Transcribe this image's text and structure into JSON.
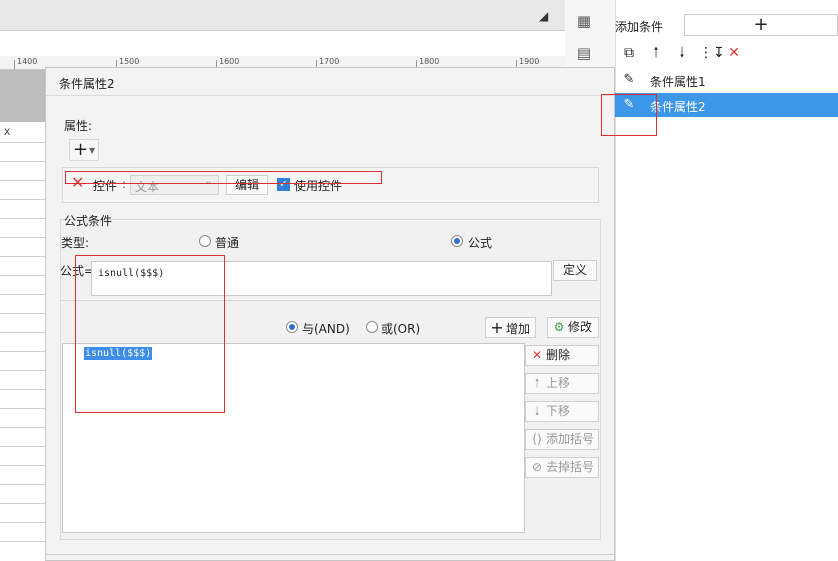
{
  "sheet": {
    "ruler_ticks": [
      "1400",
      "1500",
      "1600",
      "1700",
      "1800",
      "1900"
    ],
    "column_header": "X"
  },
  "right_panel": {
    "add_condition_label": "添加条件",
    "add_condition_button": "+",
    "toolbar_icons": [
      "copy-icon",
      "arrow-up-icon",
      "arrow-down-icon",
      "sort-down-icon",
      "delete-icon"
    ],
    "conditions": [
      {
        "label": "条件属性1",
        "selected": false
      },
      {
        "label": "条件属性2",
        "selected": true
      }
    ]
  },
  "dialog": {
    "title": "条件属性2",
    "attribute_section": {
      "label": "属性:",
      "add_button": "+",
      "row": {
        "control_label": "控件",
        "control_colon": ":",
        "control_select_value": "文本",
        "edit_button": "编辑",
        "use_control_label": "使用控件",
        "use_control_checked": true
      }
    },
    "formula_section": {
      "group_label": "公式条件",
      "type_label": "类型:",
      "type_options": [
        {
          "label": "普通",
          "checked": false
        },
        {
          "label": "公式",
          "checked": true
        }
      ],
      "formula_label": "公式=",
      "formula_value": "isnull($$$)",
      "define_button": "定义",
      "logic_options": [
        {
          "label": "与(AND)",
          "checked": true
        },
        {
          "label": "或(OR)",
          "checked": false
        }
      ],
      "add_button": "增加",
      "modify_button": "修改",
      "conditions_list": [
        "isnull($$$)"
      ],
      "side_buttons": {
        "delete": "删除",
        "move_up": "上移",
        "move_down": "下移",
        "add_paren": "添加括号",
        "remove_paren": "去掉括号"
      }
    }
  },
  "colors": {
    "selection_blue": "#3d97e8",
    "annotation_red": "#dc3030",
    "delete_red": "#e03b36",
    "checkbox_blue": "#2f80d8"
  }
}
